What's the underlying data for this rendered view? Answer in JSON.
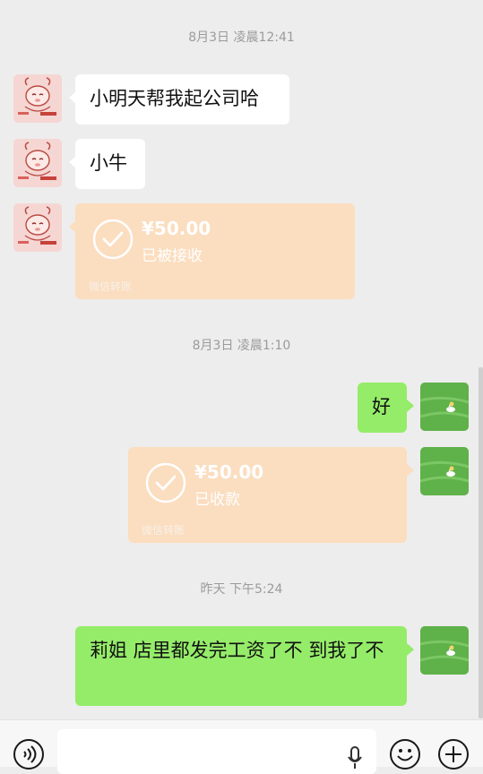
{
  "timestamps": [
    "8月3日 凌晨12:41",
    "8月3日 凌晨1:10",
    "昨天 下午5:24"
  ],
  "messages": {
    "m1": "小明天帮我起公司哈",
    "m2": "小牛",
    "m3": "好",
    "m4": "莉姐 店里都发完工资了不 到我了不"
  },
  "transfers": {
    "t1": {
      "amount": "¥50.00",
      "status": "已被接收",
      "source": "微信转账"
    },
    "t2": {
      "amount": "¥50.00",
      "status": "已收款",
      "source": "微信转账"
    }
  },
  "icons": {
    "voice": "voice-toggle-icon",
    "mic": "microphone-icon",
    "emoji": "emoji-icon",
    "plus": "plus-icon"
  },
  "colors": {
    "background": "#ededed",
    "bubble_self": "#95ec69",
    "bubble_other": "#ffffff",
    "transfer": "#fbddbf"
  }
}
